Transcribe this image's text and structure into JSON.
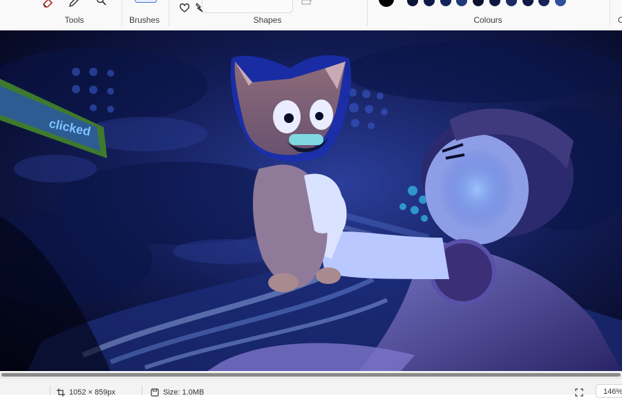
{
  "ribbon": {
    "tools": {
      "label": "Tools"
    },
    "brushes": {
      "label": "Brushes"
    },
    "shapes": {
      "label": "Shapes"
    },
    "colours": {
      "label": "Colours",
      "primary": "#000000",
      "swatches": [
        "#0b1437",
        "#0d1a45",
        "#13235a",
        "#1f3a7a",
        "#0a1230",
        "#0e1843",
        "#1a2b63",
        "#101a44",
        "#152256",
        "#2e4f9a"
      ]
    },
    "next_group_label": "C"
  },
  "canvas": {
    "sign_text": "clicked"
  },
  "status": {
    "dimensions": "1052 × 859px",
    "size": "Size: 1.0MB",
    "zoom": "146%"
  }
}
